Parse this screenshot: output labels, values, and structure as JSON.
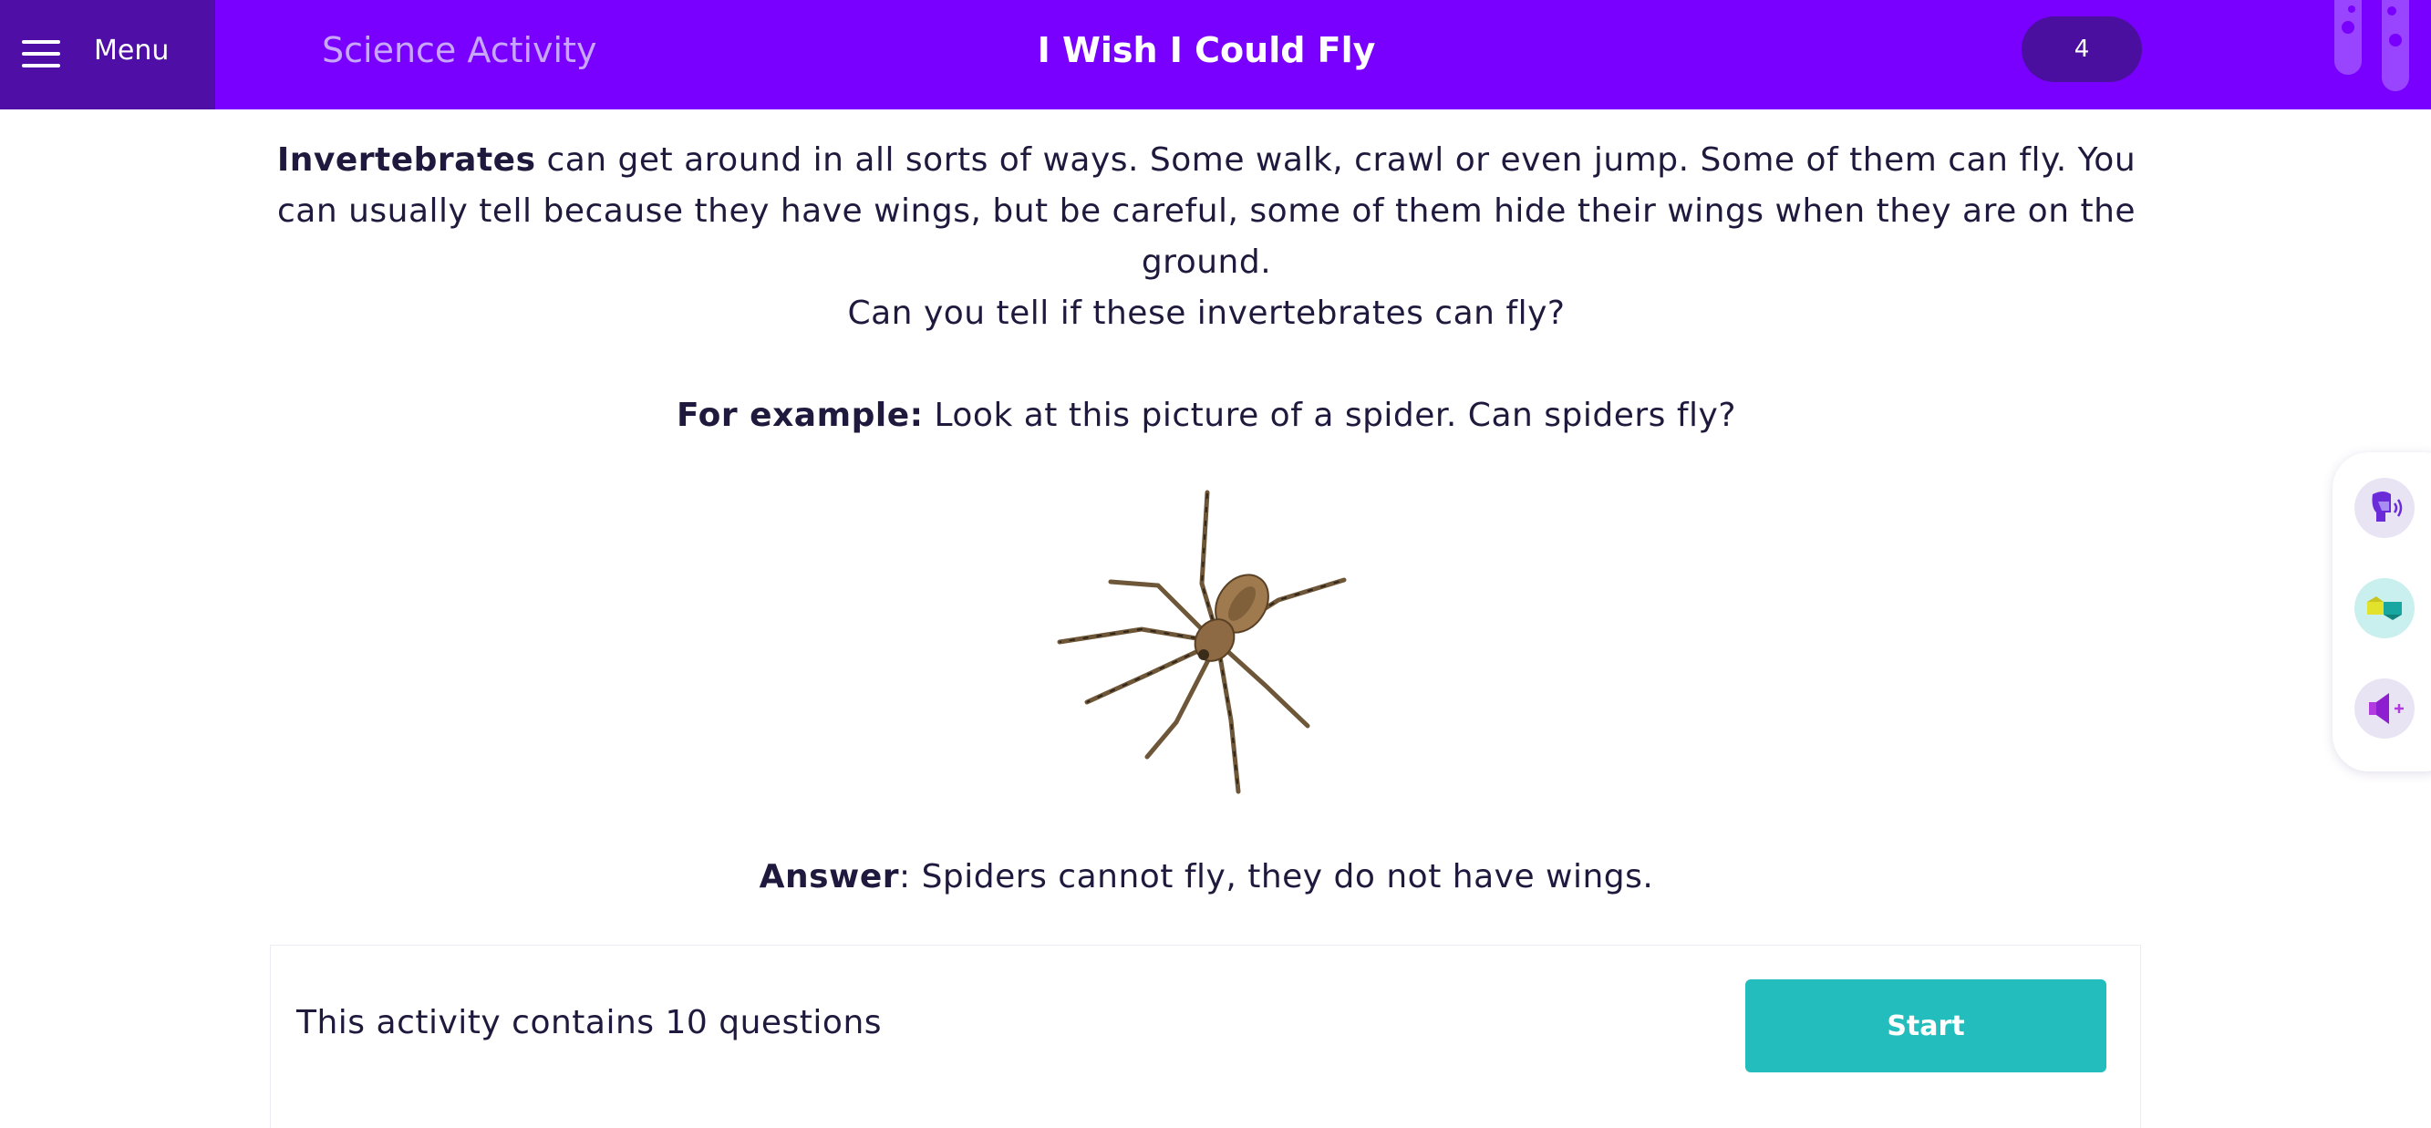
{
  "header": {
    "menu_label": "Menu",
    "subject": "Science Activity",
    "title": "I Wish I Could Fly",
    "count": "4"
  },
  "content": {
    "intro_bold": "Invertebrates",
    "intro_rest": " can get around in all sorts of ways. Some walk, crawl or even jump. Some of them can fly. You can usually tell because they have wings, but be careful, some of them hide their wings when they are on the ground.",
    "question": "Can you tell if these invertebrates can fly?",
    "example_label": "For example:",
    "example_text": " Look at this picture of a spider. Can spiders fly?",
    "answer_label": "Answer",
    "answer_text": ": Spiders cannot fly, they do not have wings."
  },
  "footer": {
    "info": "This activity contains 10 questions",
    "start_label": "Start"
  },
  "icons": {
    "menu": "hamburger-menu-icon",
    "tubes": "test-tubes-icon",
    "tools": [
      "reader-icon",
      "translate-icon",
      "audio-icon"
    ]
  },
  "colors": {
    "header": "#7900fe",
    "menu_block": "#4f0ea5",
    "pill": "#4a0f9e",
    "accent": "#23bdbd",
    "text": "#1f1a3d"
  }
}
